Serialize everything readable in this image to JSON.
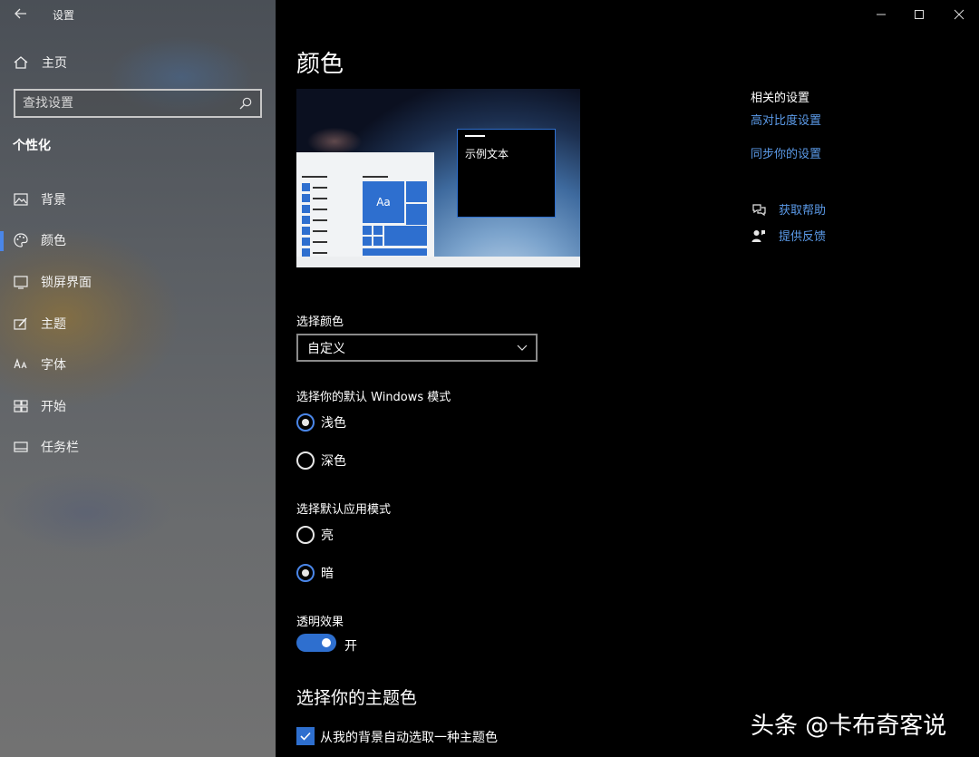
{
  "window": {
    "title": "设置"
  },
  "sidebar": {
    "home_label": "主页",
    "search_placeholder": "查找设置",
    "section_heading": "个性化",
    "items": [
      {
        "label": "背景",
        "icon": "image-icon"
      },
      {
        "label": "颜色",
        "icon": "palette-icon",
        "active": true
      },
      {
        "label": "锁屏界面",
        "icon": "lock-screen-icon"
      },
      {
        "label": "主题",
        "icon": "theme-icon"
      },
      {
        "label": "字体",
        "icon": "font-icon"
      },
      {
        "label": "开始",
        "icon": "start-icon"
      },
      {
        "label": "任务栏",
        "icon": "taskbar-icon"
      }
    ]
  },
  "main": {
    "title": "颜色",
    "preview": {
      "tile_text": "Aa",
      "sample_text": "示例文本"
    },
    "choose_color": {
      "label": "选择颜色",
      "value": "自定义"
    },
    "windows_mode": {
      "label": "选择你的默认 Windows 模式",
      "options": [
        {
          "label": "浅色",
          "checked": true
        },
        {
          "label": "深色",
          "checked": false
        }
      ]
    },
    "app_mode": {
      "label": "选择默认应用模式",
      "options": [
        {
          "label": "亮",
          "checked": false
        },
        {
          "label": "暗",
          "checked": true
        }
      ]
    },
    "transparency": {
      "label": "透明效果",
      "state": "开",
      "on": true
    },
    "accent": {
      "title": "选择你的主题色",
      "auto_pick_label": "从我的背景自动选取一种主题色",
      "checked": true
    }
  },
  "related": {
    "heading": "相关的设置",
    "links": [
      "高对比度设置",
      "同步你的设置"
    ],
    "help": [
      {
        "label": "获取帮助",
        "icon": "help-chat-icon"
      },
      {
        "label": "提供反馈",
        "icon": "feedback-icon"
      }
    ]
  },
  "watermark": "头条 @卡布奇客说",
  "colors": {
    "accent": "#2e6fcf",
    "link": "#5b9ae8",
    "background": "#000000"
  }
}
